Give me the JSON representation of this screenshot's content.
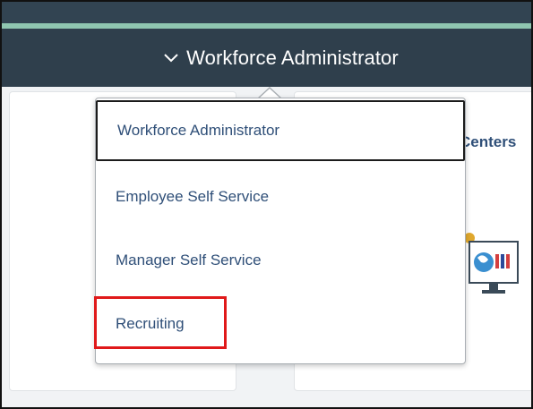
{
  "header": {
    "title": "Workforce Administrator",
    "icon": "chevron-down-icon"
  },
  "menu": {
    "items": [
      {
        "label": "Workforce Administrator",
        "selected": true
      },
      {
        "label": "Employee Self Service"
      },
      {
        "label": "Manager Self Service"
      },
      {
        "label": "Recruiting",
        "highlighted": true
      }
    ]
  },
  "background": {
    "tile_title": "Centers"
  },
  "colors": {
    "header_bg": "#2f3f4c",
    "accent": "#8fc6b0",
    "link": "#2f4f78",
    "highlight": "#e0191a"
  }
}
